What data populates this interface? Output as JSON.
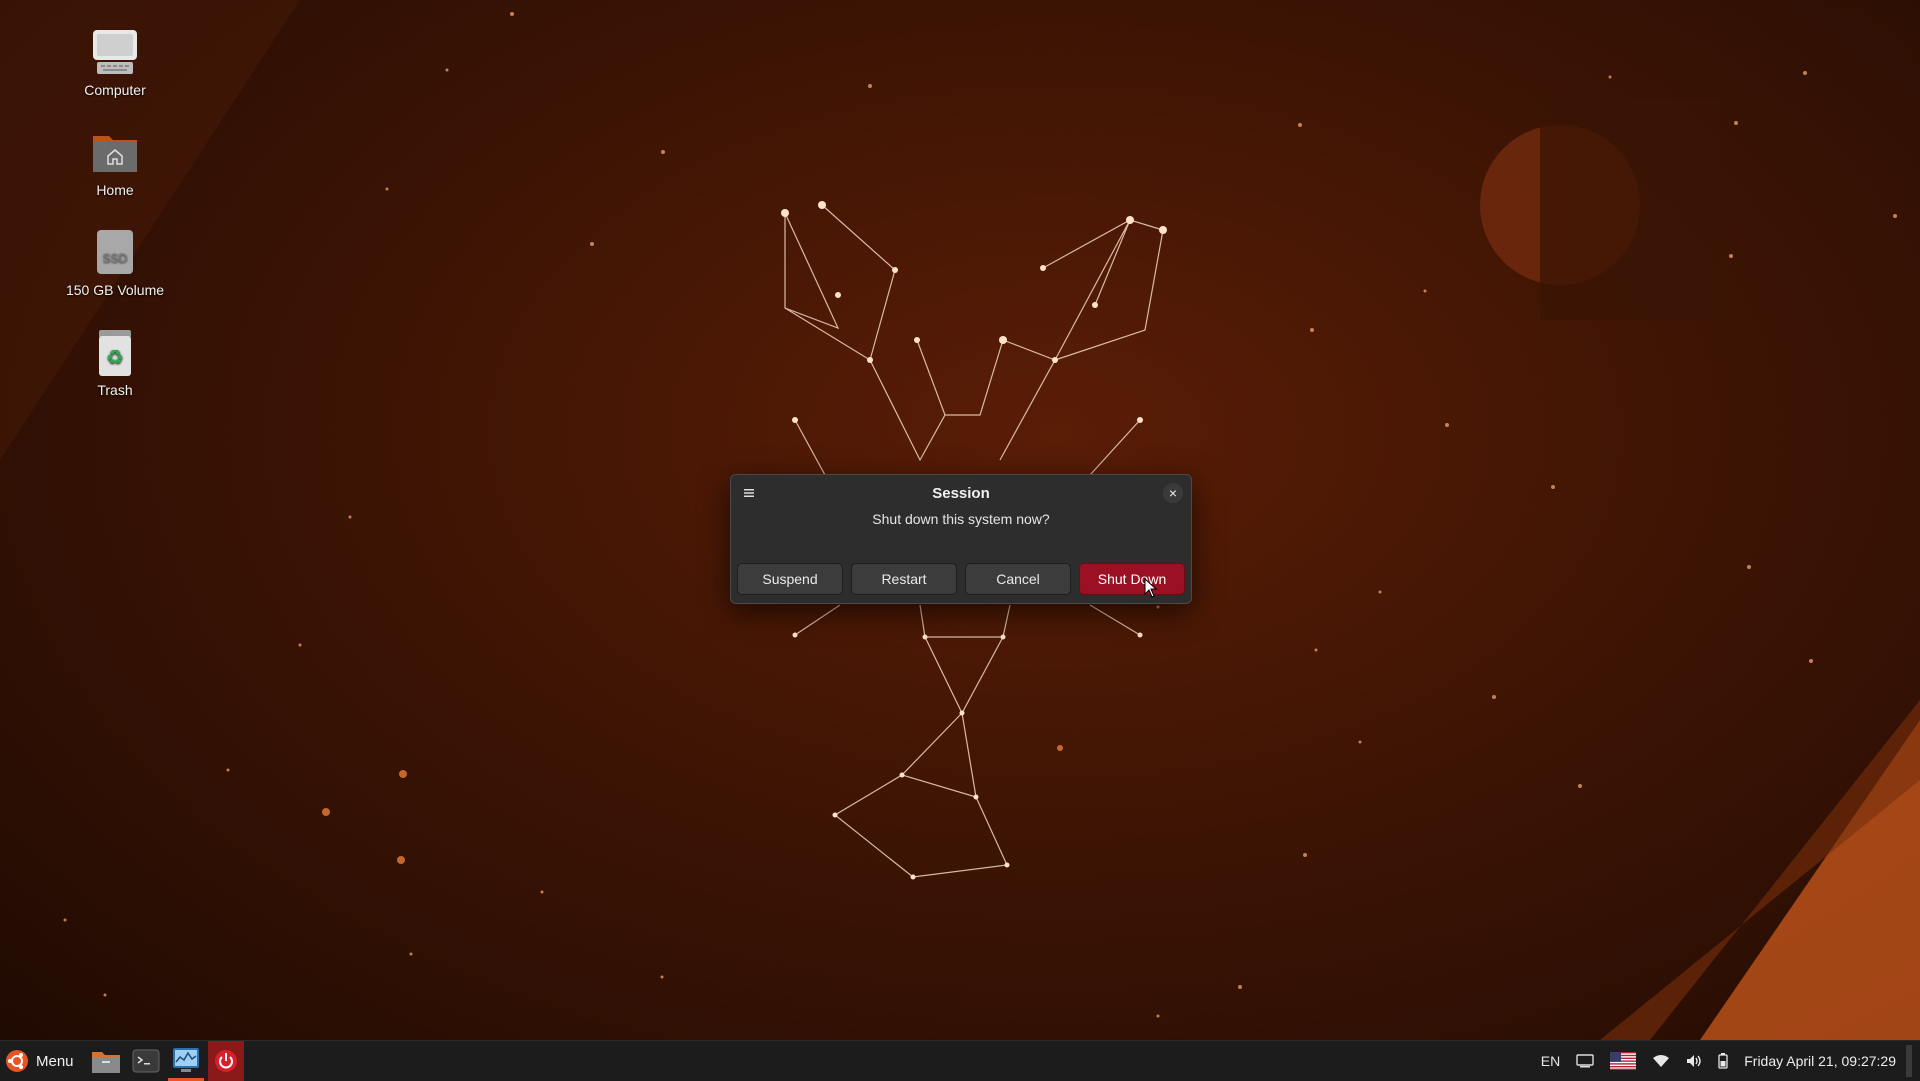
{
  "desktop": {
    "icons": [
      {
        "label": "Computer",
        "icon": "computer-icon"
      },
      {
        "label": "Home",
        "icon": "home-folder-icon"
      },
      {
        "label": "150 GB Volume",
        "icon": "ssd-drive-icon"
      },
      {
        "label": "Trash",
        "icon": "trash-icon"
      }
    ],
    "ssd_badge": "SSD"
  },
  "dialog": {
    "title": "Session",
    "message": "Shut down this system now?",
    "buttons": {
      "suspend": "Suspend",
      "restart": "Restart",
      "cancel": "Cancel",
      "shutdown": "Shut Down"
    },
    "danger_color": "#9b1022"
  },
  "taskbar": {
    "menu_label": "Menu",
    "launchers": [
      "file-manager-icon",
      "terminal-icon",
      "system-monitor-icon",
      "power-icon"
    ],
    "tray": {
      "keyboard_layout": "EN",
      "clock": "Friday April 21, 09:27:29"
    }
  },
  "colors": {
    "accent": "#e95420",
    "wallpaper_base": "#3d1404"
  }
}
